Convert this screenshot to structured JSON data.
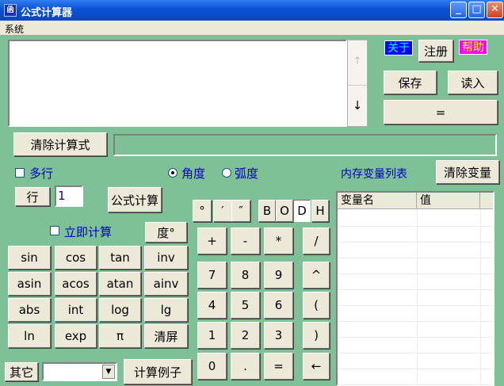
{
  "window": {
    "title": "公式计算器",
    "icon_text": "函",
    "minimize": "_",
    "maximize": "□",
    "close": "✕"
  },
  "menu": {
    "items": [
      "系统"
    ]
  },
  "top_buttons": {
    "about": "关于",
    "register": "注册",
    "help": "帮助",
    "save": "保存",
    "load": "读入",
    "equals": "="
  },
  "scroll": {
    "up": "↑",
    "down": "↓"
  },
  "expression": {
    "value": "",
    "clear_label": "清除计算式",
    "result": ""
  },
  "options": {
    "multiline": "多行",
    "degree": "角度",
    "radian": "弧度",
    "angle_mode": "degree",
    "row_label": "行",
    "row_value": "1",
    "formula_calc": "公式计算",
    "instant_calc": "立即计算",
    "degree_btn": "度°"
  },
  "memory": {
    "title": "内存变量列表",
    "clear": "清除变量",
    "columns": [
      "变量名",
      "值"
    ],
    "rows": []
  },
  "angle_symbols": [
    "°",
    "′",
    "″"
  ],
  "bases": [
    "B",
    "O",
    "D",
    "H"
  ],
  "active_base": "D",
  "func_keys": [
    [
      "sin",
      "cos",
      "tan",
      "inv"
    ],
    [
      "asin",
      "acos",
      "atan",
      "ainv"
    ],
    [
      "abs",
      "int",
      "log",
      "lg"
    ],
    [
      "ln",
      "exp",
      "π",
      "清屏"
    ]
  ],
  "num_keys": [
    [
      "+",
      "-",
      "*",
      "/"
    ],
    [
      "7",
      "8",
      "9",
      "^"
    ],
    [
      "4",
      "5",
      "6",
      "("
    ],
    [
      "1",
      "2",
      "3",
      ")"
    ],
    [
      "0",
      ".",
      "=",
      "←"
    ]
  ],
  "bottom": {
    "other": "其它",
    "select_value": "",
    "examples": "计算例子"
  },
  "colors": {
    "background": "#7ec196",
    "label_blue": "#0000c8",
    "about_bg": "#0000ff",
    "about_fg": "#00ffff",
    "help_bg": "#ff00ff",
    "help_fg": "#ffff00"
  }
}
